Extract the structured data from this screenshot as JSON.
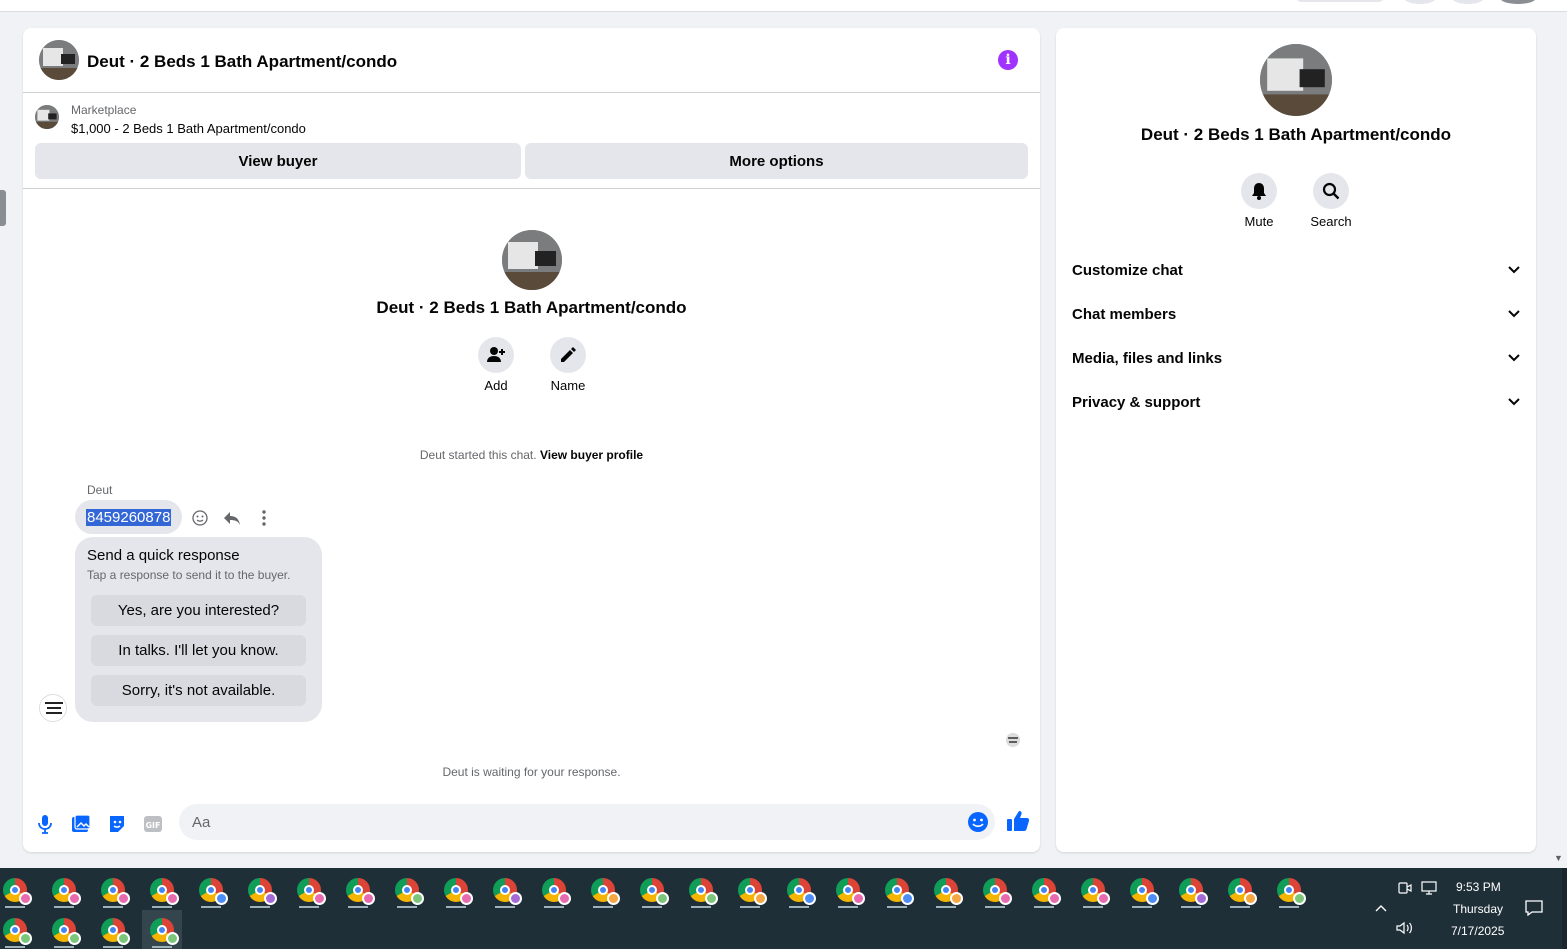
{
  "chat": {
    "header_title": "Deut · 2 Beds 1 Bath Apartment/condo",
    "marketplace": {
      "label": "Marketplace",
      "listing": "$1,000 - 2 Beds 1 Bath Apartment/condo",
      "view_buyer": "View buyer",
      "more_options": "More options"
    },
    "profile": {
      "title": "Deut · 2 Beds 1 Bath Apartment/condo",
      "add_label": "Add",
      "name_label": "Name"
    },
    "started_text": "Deut started this chat.",
    "view_buyer_profile": "View buyer profile",
    "message": {
      "sender": "Deut",
      "text": "8459260878"
    },
    "quick_response": {
      "title": "Send a quick response",
      "subtitle": "Tap a response to send it to the buyer.",
      "options": [
        "Yes, are you interested?",
        "In talks. I'll let you know.",
        "Sorry, it's not available."
      ]
    },
    "waiting_text": "Deut is waiting for your response.",
    "composer_placeholder": "Aa"
  },
  "details": {
    "title": "Deut · 2 Beds 1 Bath Apartment/condo",
    "mute_label": "Mute",
    "search_label": "Search",
    "sections": [
      "Customize chat",
      "Chat members",
      "Media, files and links",
      "Privacy & support"
    ]
  },
  "taskbar": {
    "time": "9:53 PM",
    "day": "Thursday",
    "date": "7/17/2025",
    "profile_colors": [
      "#e86bb0",
      "#e86bb0",
      "#e86bb0",
      "#e86bb0",
      "#4c8df6",
      "#a46bd6",
      "#e86bb0",
      "#e86bb0",
      "#7bc67b",
      "#e86bb0",
      "#a46bd6",
      "#e86bb0",
      "#f4a742",
      "#7bc67b",
      "#7bc67b",
      "#f4a742",
      "#4c8df6",
      "#e86bb0",
      "#4c8df6",
      "#f4a742",
      "#e86bb0",
      "#e86bb0",
      "#e86bb0",
      "#4c8df6",
      "#a46bd6",
      "#f4a742",
      "#7bc67b",
      "#7bc67b",
      "#7bc67b",
      "#7bc67b",
      "#7bc67b"
    ]
  },
  "colors": {
    "accent": "#0866ff",
    "info_purple": "#a033ff"
  }
}
